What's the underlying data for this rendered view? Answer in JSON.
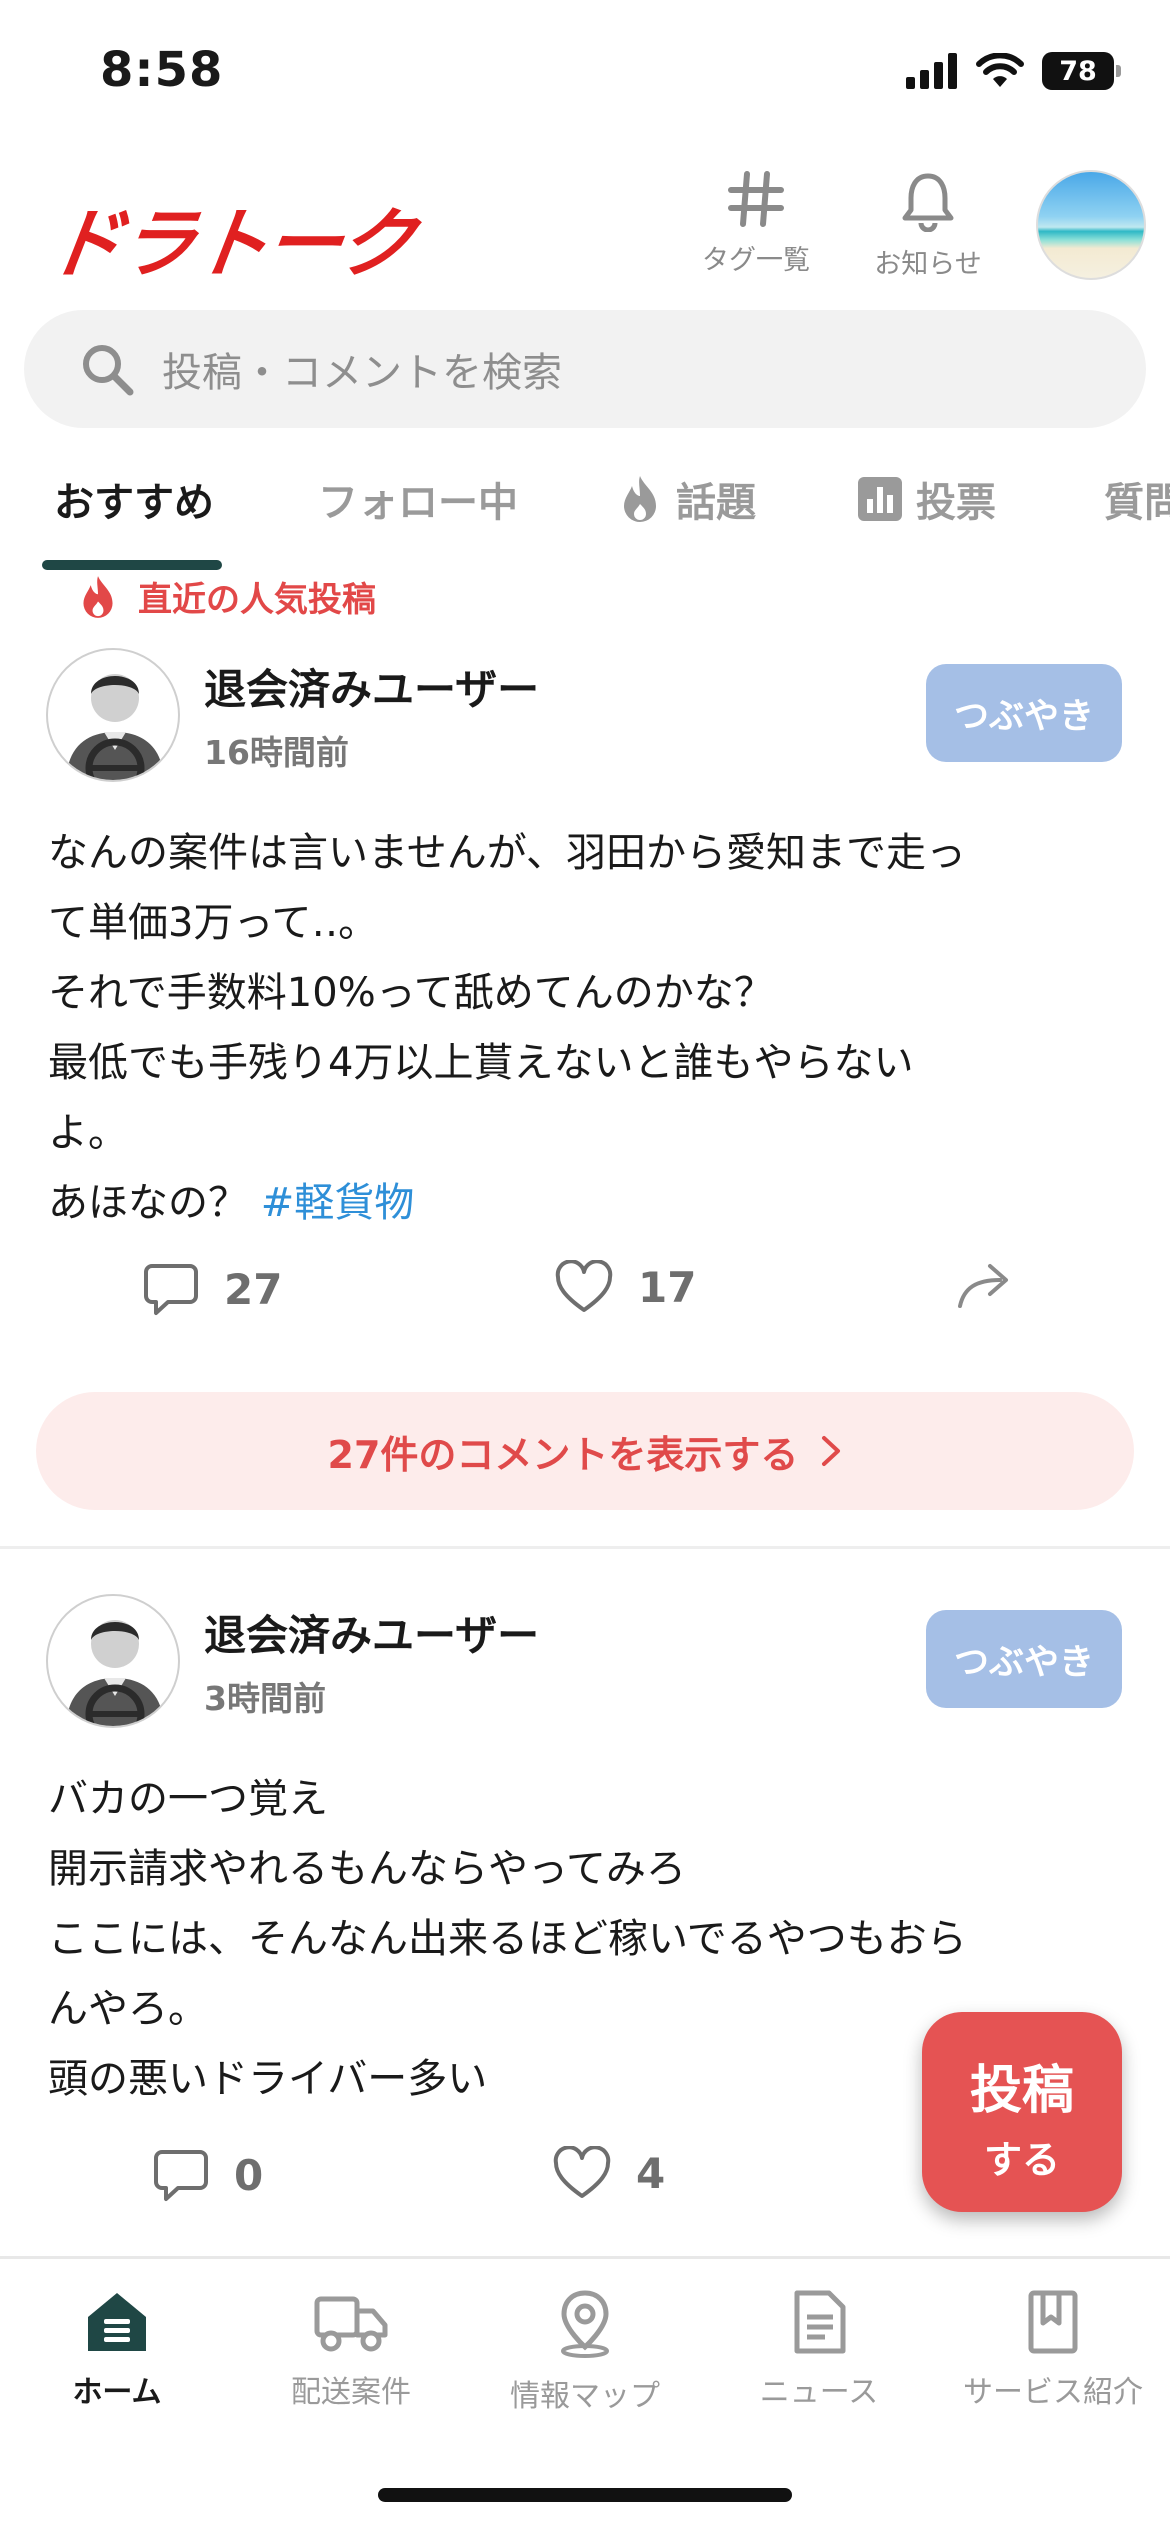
{
  "status_bar": {
    "time": "8:58",
    "battery": "78"
  },
  "header": {
    "logo": "ドラトーク",
    "actions": [
      {
        "label": "タグ一覧",
        "icon": "hash-icon"
      },
      {
        "label": "お知らせ",
        "icon": "bell-icon"
      }
    ],
    "avatar": "beach-avatar"
  },
  "search": {
    "placeholder": "投稿・コメントを検索"
  },
  "tabs": [
    {
      "label": "おすすめ",
      "active": true
    },
    {
      "label": "フォロー中"
    },
    {
      "label": "話題",
      "icon": "flame-icon"
    },
    {
      "label": "投票",
      "icon": "bar-chart-icon"
    },
    {
      "label": "質問"
    }
  ],
  "trending_label": "直近の人気投稿",
  "posts": [
    {
      "user": "退会済みユーザー",
      "time": "16時間前",
      "type": "つぶやき",
      "lines": [
        "なんの案件は言いませんが、羽田から愛知まで走っ",
        "て単価3万って‥。",
        "それで手数料10%って舐めてんのかな？",
        "最低でも手残り4万以上貰えないと誰もやらない",
        "よ。",
        "あほなの？"
      ],
      "hashtag": "#軽貨物",
      "comments": "27",
      "likes": "17",
      "show_comments": "27件のコメントを表示する"
    },
    {
      "user": "退会済みユーザー",
      "time": "3時間前",
      "type": "つぶやき",
      "lines": [
        "バカの一つ覚え",
        "開示請求やれるもんならやってみろ",
        "ここには、そんなん出来るほど稼いでるやつもおら",
        "んやろ。",
        "頭の悪いドライバー多い"
      ],
      "comments": "0",
      "likes": "4"
    }
  ],
  "fab": {
    "line1": "投稿",
    "line2": "する"
  },
  "bottom_nav": [
    {
      "label": "ホーム",
      "icon": "home-icon",
      "active": true
    },
    {
      "label": "配送案件",
      "icon": "truck-icon"
    },
    {
      "label": "情報マップ",
      "icon": "map-pin-icon"
    },
    {
      "label": "ニュース",
      "icon": "document-icon"
    },
    {
      "label": "サービス紹介",
      "icon": "bookmark-book-icon"
    }
  ],
  "colors": {
    "brand_red": "#e02020",
    "accent_green": "#1f4745",
    "type_badge": "#a5bfe6",
    "hashtag": "#2e8fd8"
  }
}
